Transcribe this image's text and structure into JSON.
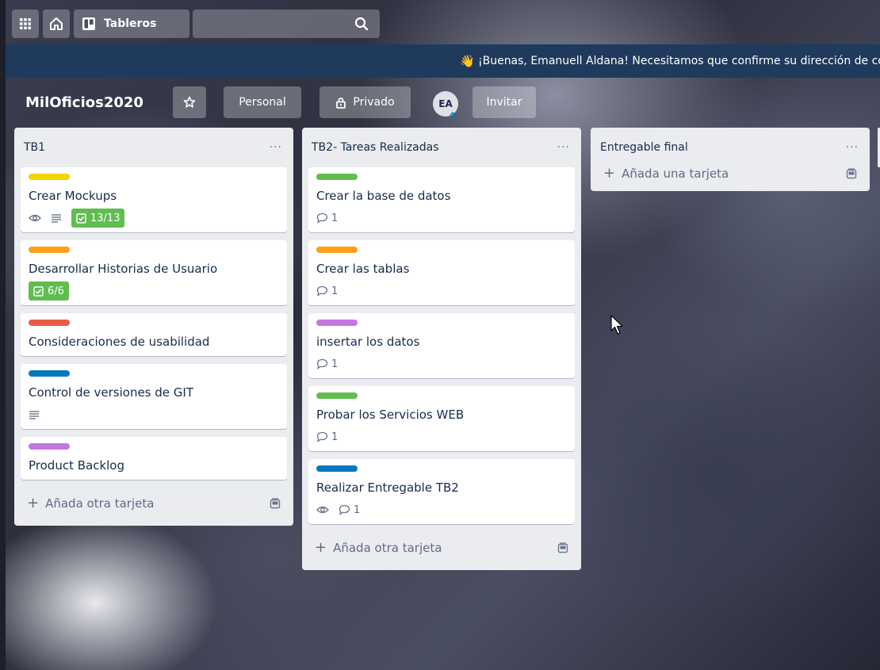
{
  "nav": {
    "boards_label": "Tableros"
  },
  "banner": {
    "text": "¡Buenas, Emanuell Aldana! Necesitamos que confirme su dirección de correo electrónico."
  },
  "board": {
    "title": "MilOficios2020",
    "team_label": "Personal",
    "visibility_label": "Privado",
    "member_initials": "EA",
    "invite_label": "Invitar"
  },
  "colors": {
    "label_yellow": "#f2d600",
    "label_orange": "#ff9f1a",
    "label_red": "#eb5a46",
    "label_blue": "#0079bf",
    "label_purple": "#c377e0",
    "label_green": "#61bd4f",
    "banner_bg": "#1f3a5c"
  },
  "lists": [
    {
      "title": "TB1",
      "menu": "···",
      "add_label": "Añada otra tarjeta",
      "cards": [
        {
          "label_color": "#f2d600",
          "title": "Crear Mockups",
          "watch": true,
          "description": true,
          "checklist": "13/13"
        },
        {
          "label_color": "#ff9f1a",
          "title": "Desarrollar Historias de Usuario",
          "checklist": "6/6"
        },
        {
          "label_color": "#eb5a46",
          "title": "Consideraciones de usabilidad"
        },
        {
          "label_color": "#0079bf",
          "title": "Control de versiones de GIT",
          "description": true
        },
        {
          "label_color": "#c377e0",
          "title": "Product Backlog"
        }
      ]
    },
    {
      "title": "TB2- Tareas Realizadas",
      "menu": "···",
      "add_label": "Añada otra tarjeta",
      "cards": [
        {
          "label_color": "#61bd4f",
          "title": "Crear la base de datos",
          "comments": "1"
        },
        {
          "label_color": "#ff9f1a",
          "title": "Crear las tablas",
          "comments": "1"
        },
        {
          "label_color": "#c377e0",
          "title": "insertar los datos",
          "comments": "1"
        },
        {
          "label_color": "#61bd4f",
          "title": "Probar los Servicios WEB",
          "comments": "1"
        },
        {
          "label_color": "#0079bf",
          "title": "Realizar Entregable TB2",
          "watch": true,
          "comments": "1"
        }
      ]
    },
    {
      "title": "Entregable final",
      "menu": "···",
      "add_label": "Añada una tarjeta",
      "cards": []
    }
  ]
}
